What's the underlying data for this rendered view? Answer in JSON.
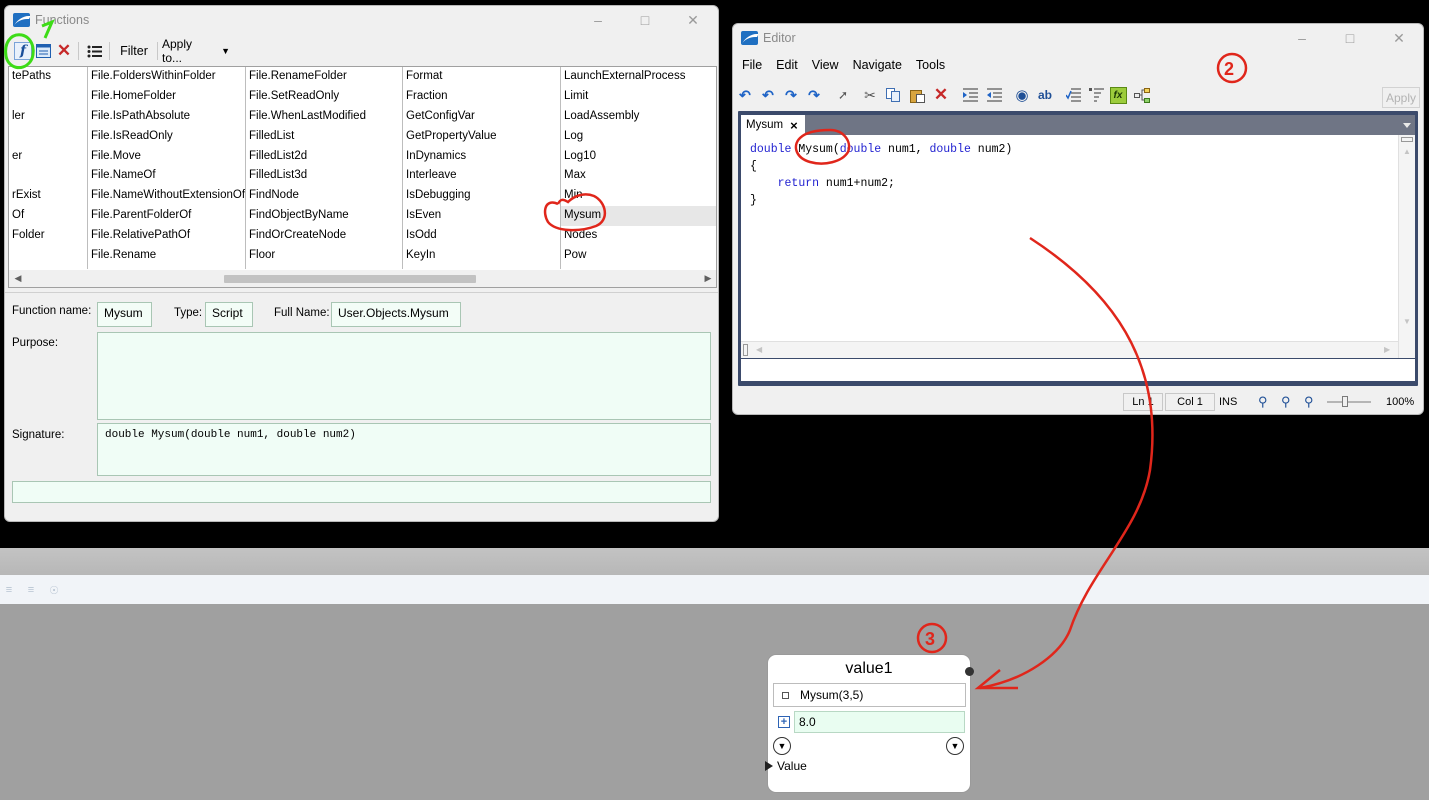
{
  "functions_window": {
    "title": "Functions",
    "toolbar": {
      "filter": "Filter",
      "apply_to": "Apply to...",
      "apply_to_arrow": "▼"
    },
    "columns": [
      [
        "tePaths",
        "",
        "ler",
        "",
        "er",
        "",
        "rExist",
        "Of",
        "Folder",
        ""
      ],
      [
        "File.FoldersWithinFolder",
        "File.HomeFolder",
        "File.IsPathAbsolute",
        "File.IsReadOnly",
        "File.Move",
        "File.NameOf",
        "File.NameWithoutExtensionOf",
        "File.ParentFolderOf",
        "File.RelativePathOf",
        "File.Rename"
      ],
      [
        "File.RenameFolder",
        "File.SetReadOnly",
        "File.WhenLastModified",
        "FilledList",
        "FilledList2d",
        "FilledList3d",
        "FindNode",
        "FindObjectByName",
        "FindOrCreateNode",
        "Floor"
      ],
      [
        "Format",
        "Fraction",
        "GetConfigVar",
        "GetPropertyValue",
        "InDynamics",
        "Interleave",
        "IsDebugging",
        "IsEven",
        "IsOdd",
        "KeyIn"
      ],
      [
        "LaunchExternalProcess",
        "Limit",
        "LoadAssembly",
        "Log",
        "Log10",
        "Max",
        "Min",
        "Mysum",
        "Nodes",
        "Pow"
      ]
    ],
    "details": {
      "function_name_label": "Function name:",
      "function_name": "Mysum",
      "type_label": "Type:",
      "type": "Script",
      "full_name_label": "Full Name:",
      "full_name": "User.Objects.Mysum",
      "purpose_label": "Purpose:",
      "purpose": "",
      "signature_label": "Signature:",
      "signature": "double Mysum(double num1, double num2)"
    }
  },
  "editor_window": {
    "title": "Editor",
    "menu": [
      "File",
      "Edit",
      "View",
      "Navigate",
      "Tools"
    ],
    "apply_label": "Apply",
    "tab_label": "Mysum",
    "code": {
      "line1_kw1": "double",
      "line1_name": " Mysum(",
      "line1_kw2": "double",
      "line1_p1": " num1, ",
      "line1_kw3": "double",
      "line1_p2": " num2)",
      "line2": "{",
      "line3_indent": "    ",
      "line3_kw": "return",
      "line3_rest": " num1+num2;",
      "line4": "}"
    },
    "status": {
      "ln": "Ln 1",
      "col": "Col 1",
      "mode": "INS",
      "zoom": "100%",
      "zoom_level": 1.0
    }
  },
  "node": {
    "title": "value1",
    "expression": "Mysum(3,5)",
    "value": "8.0",
    "output_label": "Value"
  },
  "annotations": {
    "n1": "1",
    "n2": "2",
    "n3": "3"
  }
}
